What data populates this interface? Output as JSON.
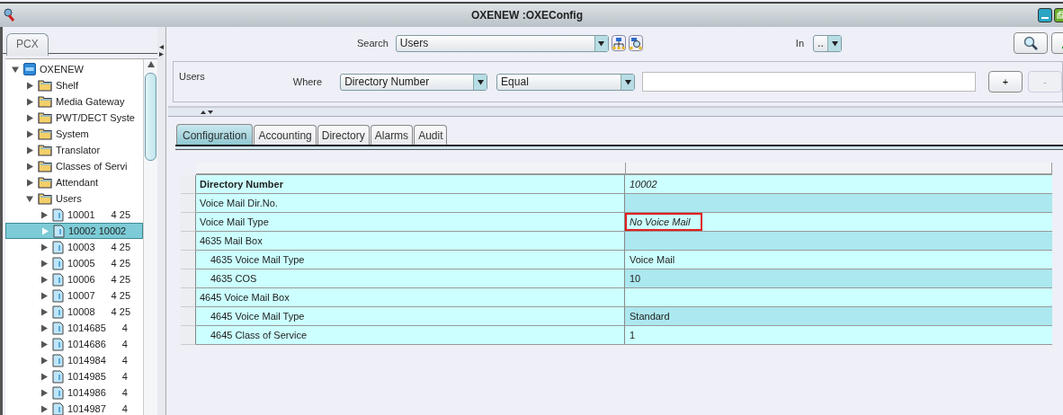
{
  "window": {
    "title": "OXENEW :OXEConfig"
  },
  "sidebar": {
    "tab": "PCX",
    "tree": [
      {
        "label": "OXENEW",
        "kind": "root",
        "expanded": true,
        "selected": false,
        "children": [
          {
            "label": "Shelf",
            "kind": "folder",
            "expanded": false,
            "selected": false
          },
          {
            "label": "Media Gateway",
            "kind": "folder",
            "expanded": false,
            "selected": false
          },
          {
            "label": "PWT/DECT Syste",
            "kind": "folder",
            "expanded": false,
            "selected": false
          },
          {
            "label": "System",
            "kind": "folder",
            "expanded": false,
            "selected": false
          },
          {
            "label": "Translator",
            "kind": "folder",
            "expanded": false,
            "selected": false
          },
          {
            "label": "Classes of Servi",
            "kind": "folder",
            "expanded": false,
            "selected": false
          },
          {
            "label": "Attendant",
            "kind": "folder",
            "expanded": false,
            "selected": false
          },
          {
            "label": "Users",
            "kind": "folder",
            "expanded": true,
            "selected": false,
            "children": [
              {
                "label": "10001",
                "detail": "4 25",
                "kind": "doc",
                "expanded": false,
                "selected": false
              },
              {
                "label": "10002 10002",
                "kind": "doc",
                "expanded": false,
                "selected": true
              },
              {
                "label": "10003",
                "detail": "4 25",
                "kind": "doc",
                "expanded": false,
                "selected": false
              },
              {
                "label": "10005",
                "detail": "4 25",
                "kind": "doc",
                "expanded": false,
                "selected": false
              },
              {
                "label": "10006",
                "detail": "4 25",
                "kind": "doc",
                "expanded": false,
                "selected": false
              },
              {
                "label": "10007",
                "detail": "4 25",
                "kind": "doc",
                "expanded": false,
                "selected": false
              },
              {
                "label": "10008",
                "detail": "4 25",
                "kind": "doc",
                "expanded": false,
                "selected": false
              },
              {
                "label": "1014685",
                "detail": "4",
                "kind": "doc",
                "expanded": false,
                "selected": false
              },
              {
                "label": "1014686",
                "detail": "4",
                "kind": "doc",
                "expanded": false,
                "selected": false
              },
              {
                "label": "1014984",
                "detail": "4",
                "kind": "doc",
                "expanded": false,
                "selected": false
              },
              {
                "label": "1014985",
                "detail": "4",
                "kind": "doc",
                "expanded": false,
                "selected": false
              },
              {
                "label": "1014986",
                "detail": "4",
                "kind": "doc",
                "expanded": false,
                "selected": false
              },
              {
                "label": "1014987",
                "detail": "4",
                "kind": "doc",
                "expanded": false,
                "selected": false
              }
            ]
          }
        ]
      }
    ]
  },
  "search": {
    "label": "Search",
    "value": "Users",
    "in_label": "In",
    "in_value": ".."
  },
  "filter": {
    "title": "Users",
    "where_label": "Where",
    "field": "Directory Number",
    "operator": "Equal",
    "buttons": [
      {
        "label": "+",
        "disabled": false
      },
      {
        "label": "-",
        "disabled": true
      }
    ]
  },
  "tabs": [
    {
      "label": "Configuration",
      "selected": true
    },
    {
      "label": "Accounting",
      "selected": false
    },
    {
      "label": "Directory",
      "selected": false
    },
    {
      "label": "Alarms",
      "selected": false
    },
    {
      "label": "Audit",
      "selected": false
    }
  ],
  "table": {
    "rows": [
      {
        "label": "Directory Number",
        "value": "10002",
        "bold": true,
        "italic": true,
        "outlined": false
      },
      {
        "label": "Voice Mail Dir.No.",
        "bold": false
      },
      {
        "label": "Voice Mail Type",
        "value": "No Voice Mail",
        "bold": false,
        "italic": true,
        "outlined": true
      },
      {
        "label": "4635 Mail Box",
        "bold": false,
        "children": [
          {
            "label": "4635 Voice Mail Type",
            "value": "Voice Mail",
            "bold": false,
            "italic": false,
            "outlined": false
          },
          {
            "label": "4635 COS",
            "value": "10",
            "bold": false,
            "italic": false,
            "outlined": false
          }
        ]
      },
      {
        "label": "4645 Voice Mail Box",
        "bold": false,
        "children": [
          {
            "label": "4645 Voice Mail Type",
            "value": "Standard",
            "bold": false,
            "italic": false,
            "outlined": false
          },
          {
            "label": "4645 Class of Service",
            "value": "1",
            "bold": false,
            "italic": false,
            "outlined": false
          }
        ]
      }
    ]
  }
}
